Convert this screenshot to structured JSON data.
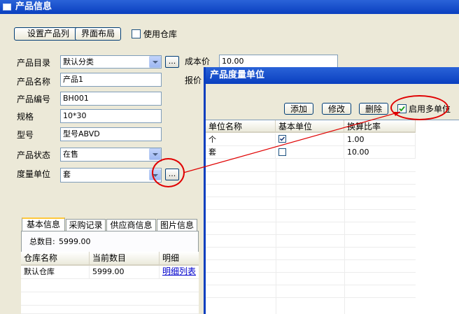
{
  "window": {
    "title": "产品信息"
  },
  "toolbar": {
    "set_columns": "设置产品列",
    "layout": "界面布局",
    "use_warehouse": "使用仓库"
  },
  "form": {
    "catalog_label": "产品目录",
    "catalog_value": "默认分类",
    "name_label": "产品名称",
    "name_value": "产品1",
    "code_label": "产品编号",
    "code_value": "BH001",
    "spec_label": "规格",
    "spec_value": "10*30",
    "model_label": "型号",
    "model_value": "型号ABVD",
    "status_label": "产品状态",
    "status_value": "在售",
    "unit_label": "度量单位",
    "unit_value": "套",
    "cost_label": "成本价",
    "cost_value": "10.00",
    "quote_label": "报价",
    "ellipsis": "..."
  },
  "tabs": [
    "基本信息",
    "采购记录",
    "供应商信息",
    "图片信息"
  ],
  "stock": {
    "total_label": "总数目:",
    "total_value": "5999.00",
    "columns": [
      "仓库名称",
      "当前数目",
      "明细"
    ],
    "rows": [
      {
        "name": "默认仓库",
        "qty": "5999.00",
        "detail": "明细列表"
      }
    ]
  },
  "dialog": {
    "title": "产品度量单位",
    "add": "添加",
    "edit": "修改",
    "delete": "删除",
    "multi_unit": "启用多单位",
    "columns": [
      "单位名称",
      "基本单位",
      "换算比率"
    ],
    "rows": [
      {
        "name": "个",
        "base": true,
        "ratio": "1.00"
      },
      {
        "name": "套",
        "base": false,
        "ratio": "10.00"
      }
    ]
  },
  "colors": {
    "titlebar": "#0a3fbf",
    "annotation": "#e00000",
    "link": "#0000cc"
  }
}
